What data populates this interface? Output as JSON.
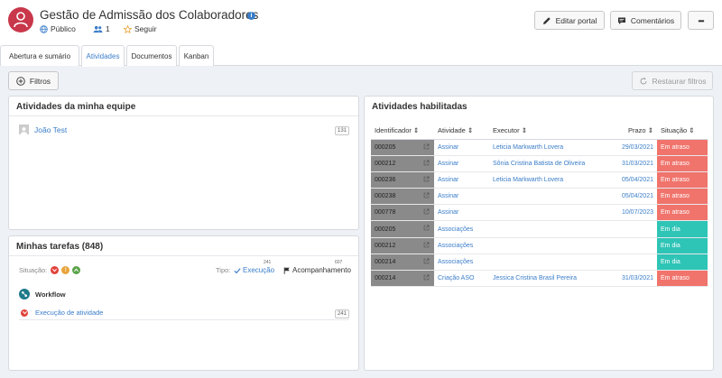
{
  "header": {
    "title": "Gestão de Admissão dos Colaboradores",
    "visibility": "Público",
    "members_count": "1",
    "follow_label": "Seguir",
    "edit_portal_label": "Editar portal",
    "comments_label": "Comentários",
    "more_label": "•••"
  },
  "tabs": [
    {
      "label": "Abertura e sumário",
      "active": false
    },
    {
      "label": "Atividades",
      "active": true
    },
    {
      "label": "Documentos",
      "active": false
    },
    {
      "label": "Kanban",
      "active": false
    }
  ],
  "toolbar": {
    "filters_label": "Filtros",
    "restore_filters_label": "Restaurar filtros"
  },
  "team_panel": {
    "title": "Atividades da minha equipe",
    "members": [
      {
        "name": "João Test",
        "count": "131"
      }
    ]
  },
  "tasks_panel": {
    "title": "Minhas tarefas (848)",
    "situation_label": "Situação:",
    "type_label": "Tipo:",
    "execution_label": "Execução",
    "execution_count": "241",
    "follow_up_label": "Acompanhamento",
    "follow_up_count": "607",
    "group_label": "Workflow",
    "items": [
      {
        "label": "Execução de atividade",
        "count": "241"
      }
    ]
  },
  "activities_panel": {
    "title": "Atividades habilitadas",
    "columns": [
      "Identificador",
      "Atividade",
      "Executor",
      "Prazo",
      "Situação"
    ],
    "rows": [
      {
        "id": "000205",
        "activity": "Assinar",
        "executor": "Leticia Markwarth Lovera",
        "deadline": "29/03/2021",
        "status": "Em atraso"
      },
      {
        "id": "000212",
        "activity": "Assinar",
        "executor": "Sônia Cristina Batista de Oliveira",
        "deadline": "31/03/2021",
        "status": "Em atraso"
      },
      {
        "id": "000236",
        "activity": "Assinar",
        "executor": "Leticia Markwarth Lovera",
        "deadline": "05/04/2021",
        "status": "Em atraso"
      },
      {
        "id": "000238",
        "activity": "Assinar",
        "executor": "",
        "deadline": "05/04/2021",
        "status": "Em atraso"
      },
      {
        "id": "000778",
        "activity": "Assinar",
        "executor": "",
        "deadline": "10/07/2023",
        "status": "Em atraso"
      },
      {
        "id": "000205",
        "activity": "Associações",
        "executor": "",
        "deadline": "",
        "status": "Em dia"
      },
      {
        "id": "000212",
        "activity": "Associações",
        "executor": "",
        "deadline": "",
        "status": "Em dia"
      },
      {
        "id": "000214",
        "activity": "Associações",
        "executor": "",
        "deadline": "",
        "status": "Em dia"
      },
      {
        "id": "000214",
        "activity": "Criação ASO",
        "executor": "Jessica Cristina Brasil Pereira",
        "deadline": "31/03/2021",
        "status": "Em atraso"
      }
    ]
  },
  "colors": {
    "brand": "#c9374b",
    "accent": "#3a7dc9",
    "late": "#f0746c",
    "on_time": "#2ec4b6",
    "id_cell": "#8a8a8a"
  }
}
